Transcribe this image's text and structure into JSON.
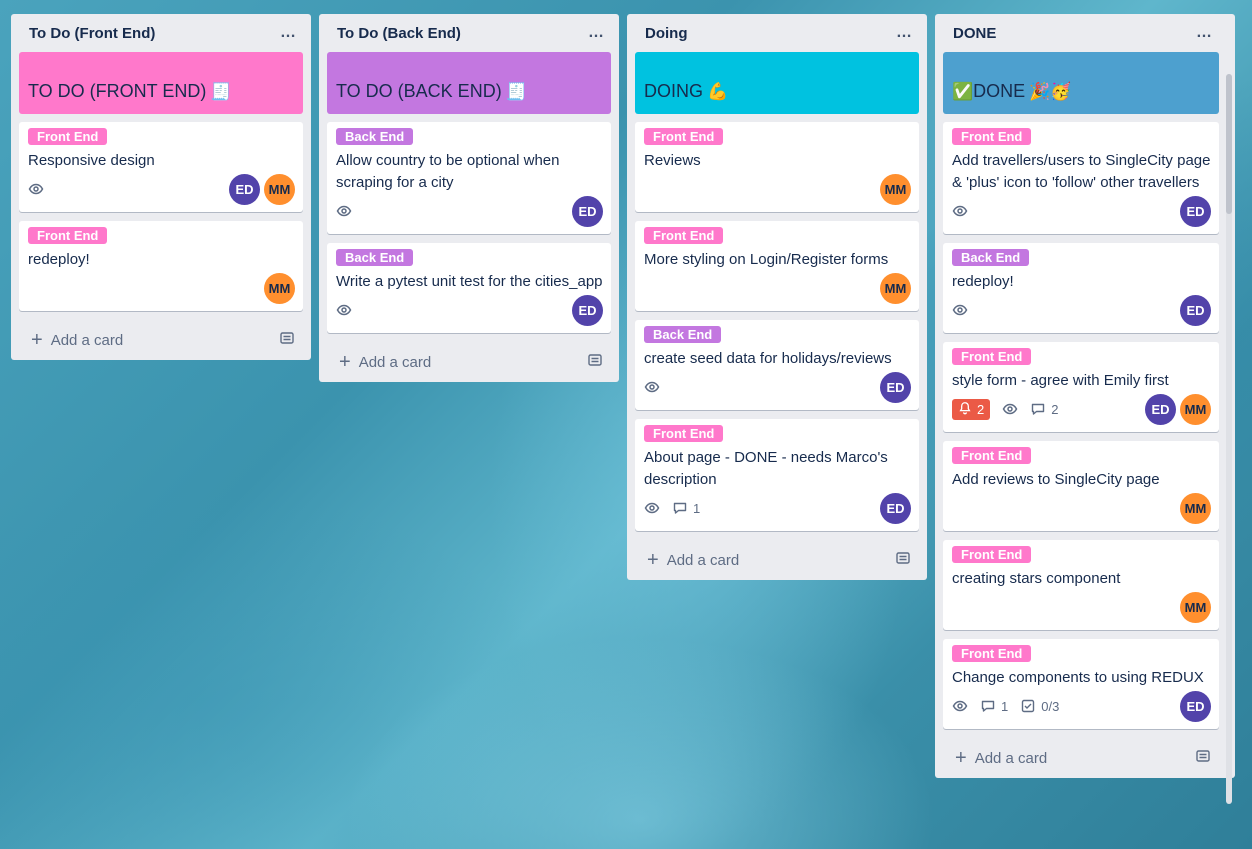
{
  "lists": [
    {
      "title": "To Do (Front End)",
      "menu": "…",
      "cover_text": "TO DO (FRONT END)",
      "cover_emoji": "🧾",
      "cover_color": "#ff78cb",
      "cards": [
        {
          "label": "Front End",
          "title": "Responsive design",
          "watch": true,
          "members": [
            "ED",
            "MM"
          ]
        },
        {
          "label": "Front End",
          "title": "redeploy!",
          "members": [
            "MM"
          ]
        }
      ],
      "add_card": "Add a card"
    },
    {
      "title": "To Do (Back End)",
      "menu": "…",
      "cover_text": "TO DO (BACK END)",
      "cover_emoji": "🧾",
      "cover_color": "#c377e0",
      "cards": [
        {
          "label": "Back End",
          "title": "Allow country to be optional when scraping for a city",
          "watch": true,
          "members": [
            "ED"
          ]
        },
        {
          "label": "Back End",
          "title": "Write a pytest unit test for the cities_app",
          "watch": true,
          "members": [
            "ED"
          ]
        }
      ],
      "add_card": "Add a card"
    },
    {
      "title": "Doing",
      "menu": "…",
      "cover_text": "DOING",
      "cover_emoji": "💪",
      "cover_color": "#00c2e0",
      "cards": [
        {
          "label": "Front End",
          "title": "Reviews",
          "members": [
            "MM"
          ]
        },
        {
          "label": "Front End",
          "title": "More styling on Login/Register forms",
          "members": [
            "MM"
          ]
        },
        {
          "label": "Back End",
          "title": "create seed data for holidays/reviews",
          "watch": true,
          "members": [
            "ED"
          ]
        },
        {
          "label": "Front End",
          "title": "About page - DONE - needs Marco's description",
          "watch": true,
          "comments": "1",
          "members": [
            "ED"
          ]
        }
      ],
      "add_card": "Add a card"
    },
    {
      "title": "DONE",
      "menu": "…",
      "cover_prefix": "✅",
      "cover_text": "DONE",
      "cover_emoji": "🎉🥳",
      "cover_color": "#4da0cf",
      "cards": [
        {
          "label": "Front End",
          "title": "Add travellers/users to SingleCity page & 'plus' icon to 'follow' other travellers",
          "watch": true,
          "members": [
            "ED"
          ]
        },
        {
          "label": "Back End",
          "title": "redeploy!",
          "watch": true,
          "members": [
            "ED"
          ]
        },
        {
          "label": "Front End",
          "title": "style form - agree with Emily first",
          "notifications": "2",
          "watch": true,
          "comments": "2",
          "members": [
            "ED",
            "MM"
          ]
        },
        {
          "label": "Front End",
          "title": "Add reviews to SingleCity page",
          "members": [
            "MM"
          ]
        },
        {
          "label": "Front End",
          "title": "creating stars component",
          "members": [
            "MM"
          ]
        },
        {
          "label": "Front End",
          "title": "Change components to using REDUX",
          "watch": true,
          "comments": "1",
          "checklist": "0/3",
          "members": [
            "ED"
          ]
        }
      ],
      "add_card": "Add a card"
    }
  ],
  "colors": {
    "front_end": "#ff78cb",
    "back_end": "#c377e0",
    "avatar_ed": "#5243aa",
    "avatar_mm": "#ff8f2e"
  },
  "icons": {
    "watch": "eye-icon",
    "comment": "comment-icon",
    "checklist": "checklist-icon",
    "notification": "bell-icon",
    "template": "card-template-icon",
    "menu": "more-icon"
  }
}
